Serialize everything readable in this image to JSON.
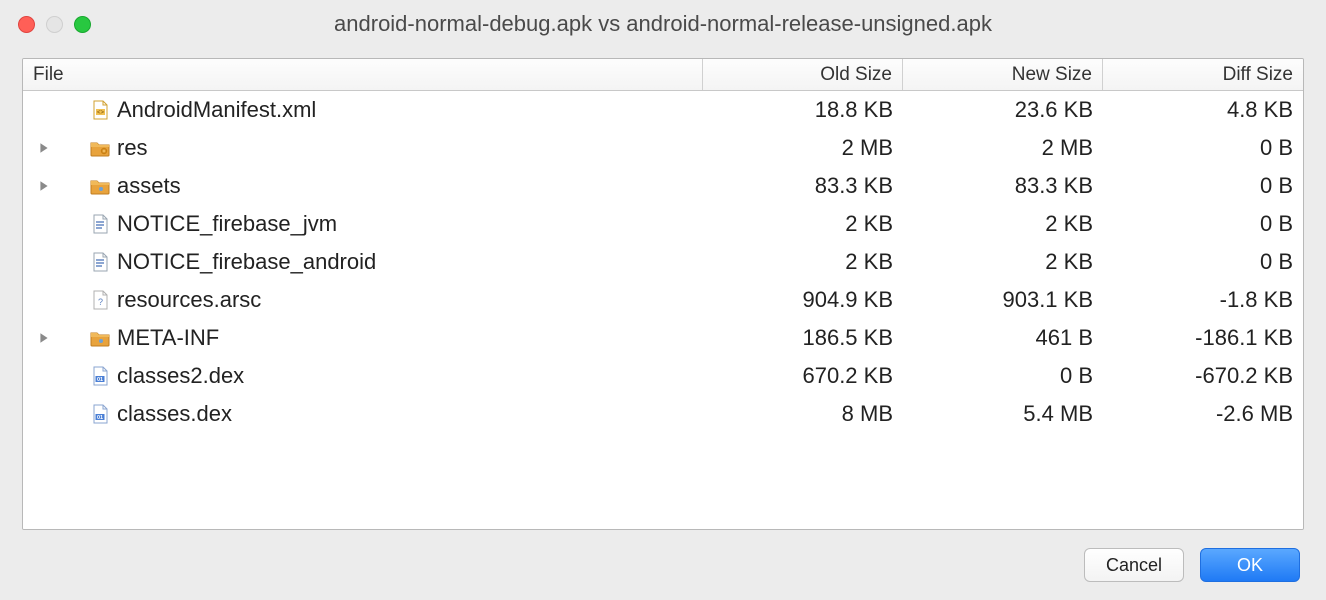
{
  "title": "android-normal-debug.apk vs android-normal-release-unsigned.apk",
  "columns": {
    "file": "File",
    "old": "Old Size",
    "new": "New Size",
    "diff": "Diff Size"
  },
  "buttons": {
    "cancel": "Cancel",
    "ok": "OK"
  },
  "rows": [
    {
      "expandable": false,
      "icon": "xml",
      "name": "AndroidManifest.xml",
      "old": "18.8 KB",
      "new": "23.6 KB",
      "diff": "4.8 KB"
    },
    {
      "expandable": true,
      "icon": "folder-res",
      "name": "res",
      "old": "2 MB",
      "new": "2 MB",
      "diff": "0 B"
    },
    {
      "expandable": true,
      "icon": "folder",
      "name": "assets",
      "old": "83.3 KB",
      "new": "83.3 KB",
      "diff": "0 B"
    },
    {
      "expandable": false,
      "icon": "text",
      "name": "NOTICE_firebase_jvm",
      "old": "2 KB",
      "new": "2 KB",
      "diff": "0 B"
    },
    {
      "expandable": false,
      "icon": "text",
      "name": "NOTICE_firebase_android",
      "old": "2 KB",
      "new": "2 KB",
      "diff": "0 B"
    },
    {
      "expandable": false,
      "icon": "unknown",
      "name": "resources.arsc",
      "old": "904.9 KB",
      "new": "903.1 KB",
      "diff": "-1.8 KB"
    },
    {
      "expandable": true,
      "icon": "folder",
      "name": "META-INF",
      "old": "186.5 KB",
      "new": "461 B",
      "diff": "-186.1 KB"
    },
    {
      "expandable": false,
      "icon": "dex",
      "name": "classes2.dex",
      "old": "670.2 KB",
      "new": "0 B",
      "diff": "-670.2 KB"
    },
    {
      "expandable": false,
      "icon": "dex",
      "name": "classes.dex",
      "old": "8 MB",
      "new": "5.4 MB",
      "diff": "-2.6 MB"
    }
  ]
}
